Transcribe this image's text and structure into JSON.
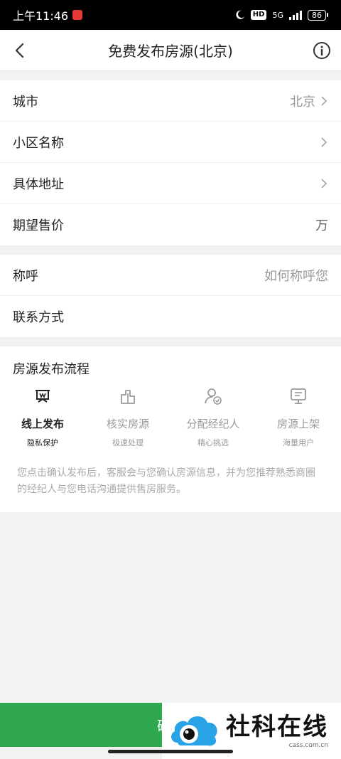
{
  "status_bar": {
    "time": "上午11:46",
    "hd": "HD",
    "network": "5G",
    "battery": "86"
  },
  "nav": {
    "title": "免费发布房源(北京)"
  },
  "property": {
    "city_label": "城市",
    "city_value": "北京",
    "community_label": "小区名称",
    "address_label": "具体地址",
    "price_label": "期望售价",
    "price_unit": "万"
  },
  "contact": {
    "name_label": "称呼",
    "name_placeholder": "如何称呼您",
    "phone_label": "联系方式"
  },
  "process": {
    "title": "房源发布流程",
    "steps": [
      {
        "name": "线上发布",
        "sub": "隐私保护",
        "icon": "broadcast-icon"
      },
      {
        "name": "核实房源",
        "sub": "极速处理",
        "icon": "building-icon"
      },
      {
        "name": "分配经纪人",
        "sub": "精心挑选",
        "icon": "agent-check-icon"
      },
      {
        "name": "房源上架",
        "sub": "海量用户",
        "icon": "monitor-icon"
      }
    ],
    "description": "您点击确认发布后，客服会与您确认房源信息，并为您推荐熟悉商圈的经纪人与您电话沟通提供售房服务。"
  },
  "footer": {
    "confirm_label": "确定"
  },
  "watermark": {
    "title": "社科在线",
    "url": "cass.com.cn"
  },
  "colors": {
    "accent": "#2fa84f",
    "background": "#f2f2f2",
    "muted_text": "#999999"
  }
}
